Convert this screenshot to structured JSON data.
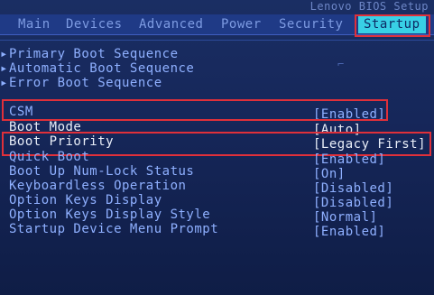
{
  "brand": "Lenovo BIOS Setup",
  "menu": [
    {
      "label": "Main",
      "active": false
    },
    {
      "label": "Devices",
      "active": false
    },
    {
      "label": "Advanced",
      "active": false
    },
    {
      "label": "Power",
      "active": false
    },
    {
      "label": "Security",
      "active": false
    },
    {
      "label": "Startup",
      "active": true
    }
  ],
  "submenus": [
    {
      "label": "Primary Boot Sequence"
    },
    {
      "label": "Automatic Boot Sequence"
    },
    {
      "label": "Error Boot Sequence"
    }
  ],
  "settings": [
    {
      "label": "CSM",
      "value": "[Enabled]"
    },
    {
      "label": "Boot Mode",
      "value": "[Auto]"
    },
    {
      "label": "Boot Priority",
      "value": "[Legacy First]"
    },
    {
      "label": "Quick Boot",
      "value": "[Enabled]"
    },
    {
      "label": "Boot Up Num-Lock Status",
      "value": "[On]"
    },
    {
      "label": "Keyboardless Operation",
      "value": "[Disabled]"
    },
    {
      "label": "Option Keys Display",
      "value": "[Disabled]"
    },
    {
      "label": "Option Keys Display Style",
      "value": "[Normal]"
    },
    {
      "label": "Startup Device Menu Prompt",
      "value": "[Enabled]"
    }
  ],
  "colors": {
    "accent": "#38d0e6",
    "highlight": "#e0303a",
    "text": "#8fb0ff"
  }
}
